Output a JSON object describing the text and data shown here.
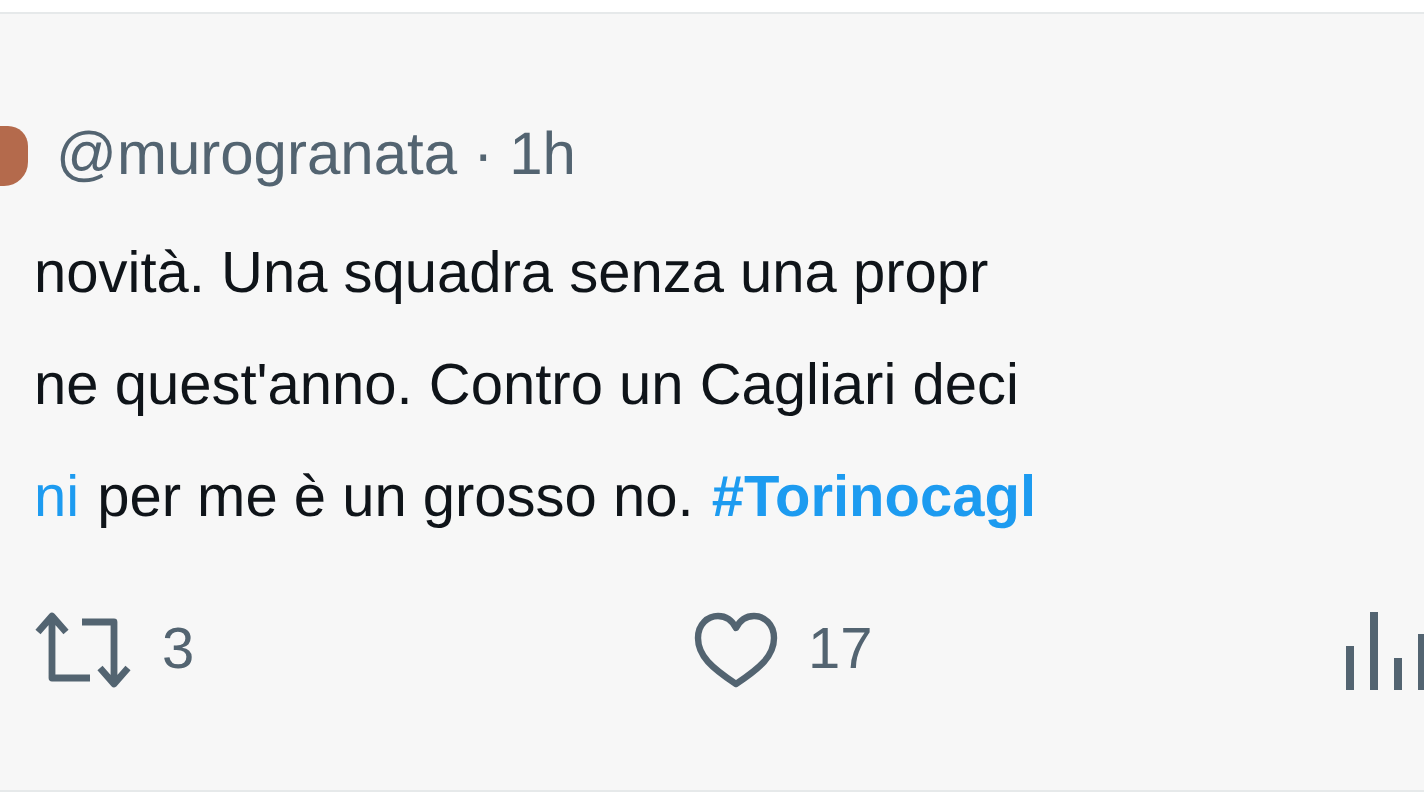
{
  "tweet": {
    "handle": "@murogranata",
    "separator": "·",
    "time": "1h",
    "lines": [
      [
        {
          "kind": "text",
          "text": "novità. Una squadra senza una propr"
        }
      ],
      [
        {
          "kind": "text",
          "text": "ne quest'anno. Contro un Cagliari deci"
        }
      ],
      [
        {
          "kind": "link",
          "text": "ni"
        },
        {
          "kind": "text",
          "text": "per me è un grosso no."
        },
        {
          "kind": "hashtag",
          "text": "#Torinocagl"
        }
      ]
    ],
    "actions": [
      {
        "kind": "retweet",
        "count": "3"
      },
      {
        "kind": "like",
        "count": "17"
      },
      {
        "kind": "views"
      }
    ]
  }
}
